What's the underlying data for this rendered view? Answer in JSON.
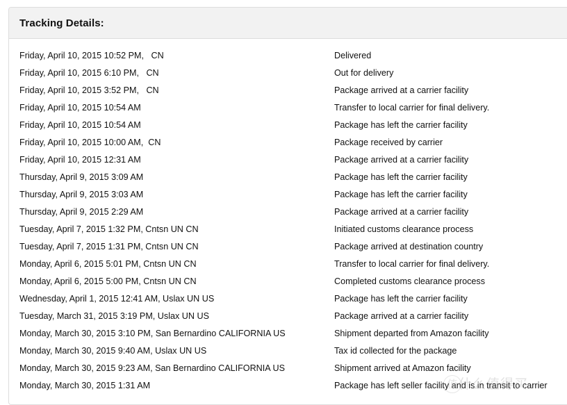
{
  "panel": {
    "title": "Tracking Details:"
  },
  "events": [
    {
      "date": "Friday, April 10, 2015 10:52 PM,   CN",
      "status": "Delivered"
    },
    {
      "date": "Friday, April 10, 2015 6:10 PM,   CN",
      "status": "Out for delivery"
    },
    {
      "date": "Friday, April 10, 2015 3:52 PM,   CN",
      "status": "Package arrived at a carrier facility"
    },
    {
      "date": "Friday, April 10, 2015 10:54 AM",
      "status": "Transfer to local carrier for final delivery."
    },
    {
      "date": "Friday, April 10, 2015 10:54 AM",
      "status": "Package has left the carrier facility"
    },
    {
      "date": "Friday, April 10, 2015 10:00 AM,  CN",
      "status": "Package received by carrier"
    },
    {
      "date": "Friday, April 10, 2015 12:31 AM",
      "status": "Package arrived at a carrier facility"
    },
    {
      "date": "Thursday, April 9, 2015 3:09 AM",
      "status": "Package has left the carrier facility"
    },
    {
      "date": "Thursday, April 9, 2015 3:03 AM",
      "status": "Package has left the carrier facility"
    },
    {
      "date": "Thursday, April 9, 2015 2:29 AM",
      "status": "Package arrived at a carrier facility"
    },
    {
      "date": "Tuesday, April 7, 2015 1:32 PM, Cntsn UN CN",
      "status": "Initiated customs clearance process"
    },
    {
      "date": "Tuesday, April 7, 2015 1:31 PM, Cntsn UN CN",
      "status": "Package arrived at destination country"
    },
    {
      "date": "Monday, April 6, 2015 5:01 PM, Cntsn UN CN",
      "status": "Transfer to local carrier for final delivery."
    },
    {
      "date": "Monday, April 6, 2015 5:00 PM, Cntsn UN CN",
      "status": "Completed customs clearance process"
    },
    {
      "date": "Wednesday, April 1, 2015 12:41 AM, Uslax UN US",
      "status": "Package has left the carrier facility"
    },
    {
      "date": "Tuesday, March 31, 2015 3:19 PM, Uslax UN US",
      "status": "Package arrived at a carrier facility"
    },
    {
      "date": "Monday, March 30, 2015 3:10 PM, San Bernardino CALIFORNIA US",
      "status": "Shipment departed from Amazon facility"
    },
    {
      "date": "Monday, March 30, 2015 9:40 AM, Uslax UN US",
      "status": "Tax id collected for the package"
    },
    {
      "date": "Monday, March 30, 2015 9:23 AM, San Bernardino CALIFORNIA US",
      "status": "Shipment arrived at Amazon facility"
    },
    {
      "date": "Monday, March 30, 2015 1:31 AM",
      "status": "Package has left seller facility and is in transit to carrier"
    }
  ],
  "watermark": {
    "mark": "值",
    "text": "什么值得买"
  }
}
